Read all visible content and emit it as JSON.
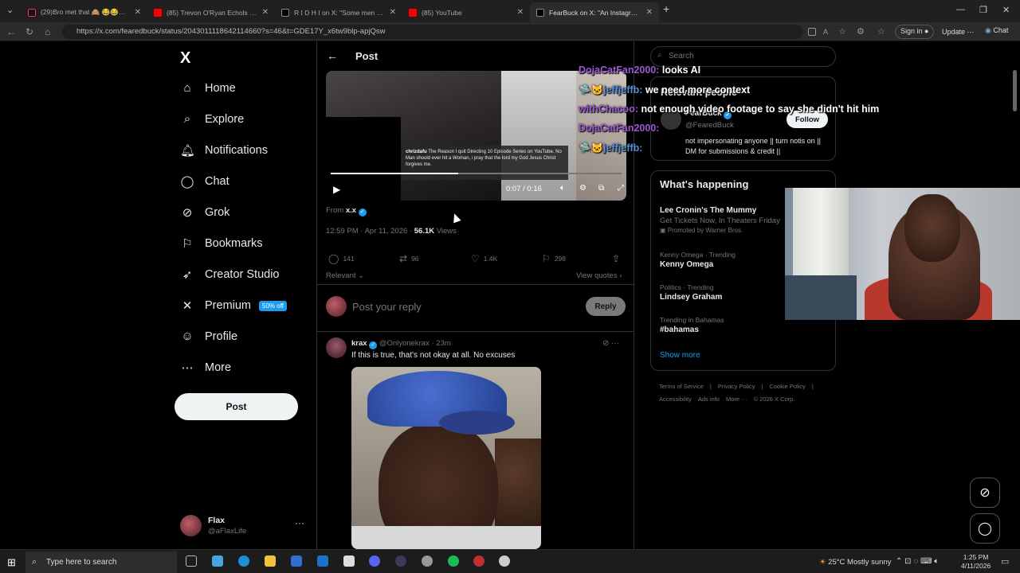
{
  "browser": {
    "tabs": [
      {
        "title": "(29)Bro met that 🙈 😂😂😂 #fy",
        "active": false,
        "color": "#fe2c55"
      },
      {
        "title": "(85) Trevon O'Ryan Echols - YouT",
        "active": false,
        "color": "#ff0000"
      },
      {
        "title": "R I D H I on X: \"Some men are sic",
        "active": false,
        "color": "#ffffff"
      },
      {
        "title": "(85) YouTube",
        "active": false,
        "color": "#ff0000"
      },
      {
        "title": "FearBuck on X: \"An Instagram use",
        "active": true,
        "color": "#ffffff"
      }
    ],
    "new_tab": "+",
    "url": "https://x.com/fearedbuck/status/2043011118642114660?s=46&t=GDE17Y_x6tw9blp-apjQsw",
    "sign_in": "Sign in",
    "update": "Update",
    "chat": "Chat"
  },
  "sidebar": {
    "logo": "X",
    "items": [
      {
        "label": "Home",
        "icon": "home-icon",
        "glyph": "⌂"
      },
      {
        "label": "Explore",
        "icon": "search-icon",
        "glyph": "⌕"
      },
      {
        "label": "Notifications",
        "icon": "bell-icon",
        "glyph": "🔔︎"
      },
      {
        "label": "Chat",
        "icon": "chat-bubble-icon",
        "glyph": "◯"
      },
      {
        "label": "Grok",
        "icon": "grok-icon",
        "glyph": "⊘"
      },
      {
        "label": "Bookmarks",
        "icon": "bookmark-icon",
        "glyph": "⚐"
      },
      {
        "label": "Creator Studio",
        "icon": "rocket-icon",
        "glyph": "➶"
      },
      {
        "label": "Premium",
        "icon": "x-icon",
        "glyph": "✕",
        "badge": "50% off"
      },
      {
        "label": "Profile",
        "icon": "person-icon",
        "glyph": "☺"
      },
      {
        "label": "More",
        "icon": "more-circle-icon",
        "glyph": "⋯"
      }
    ],
    "post_button": "Post",
    "account": {
      "name": "Flax",
      "handle": "@aFlaxLife",
      "more": "···"
    }
  },
  "post": {
    "header": "Post",
    "video": {
      "caption_user": "chrizdafu",
      "caption_text": "The Reason I quit Directing 10 Episode Series on YouTube. No Man should ever hit a Woman, i pray that the lord my God Jesus Christ forgives me.",
      "time": "0:07 / 0:16",
      "progress": 0.4375
    },
    "from_label": "From",
    "from_user": "x.x",
    "timestamp": "12:59 PM · Apr 11, 2026",
    "views_count": "56.1K",
    "views_label": "Views",
    "actions": {
      "replies": "141",
      "reposts": "96",
      "likes": "1.4K",
      "bookmarks": "298"
    },
    "relevant": "Relevant",
    "view_quotes": "View quotes",
    "reply_placeholder": "Post your reply",
    "reply_button": "Reply"
  },
  "reply_tweet": {
    "name": "krax",
    "handle": "@Onlyonekrax",
    "time": "23m",
    "text": "If this is true, that's not okay at all. No excuses"
  },
  "right": {
    "search_placeholder": "Search",
    "relevant_people_title": "Relevant people",
    "person": {
      "name": "FearBuck",
      "handle": "@FearedBuck",
      "follow": "Follow",
      "bio": "not impersonating anyone || turn notis on || DM for submissions & credit ||"
    },
    "whats_happening": "What's happening",
    "trends": [
      {
        "context": "",
        "title": "Lee Cronin's The Mummy",
        "sub": "Get Tickets Now, In Theaters Friday",
        "promo": "Promoted by Warner Bros."
      },
      {
        "context": "Kenny Omega · Trending",
        "title": "Kenny Omega",
        "sub": "",
        "promo": ""
      },
      {
        "context": "Politics · Trending",
        "title": "Lindsey Graham",
        "sub": "",
        "promo": ""
      },
      {
        "context": "Trending in Bahamas",
        "title": "#bahamas",
        "sub": "",
        "promo": ""
      }
    ],
    "show_more": "Show more",
    "footer": [
      "Terms of Service",
      "|",
      "Privacy Policy",
      "|",
      "Cookie Policy",
      "|",
      "Accessibility",
      "Ads info",
      "More ···",
      "© 2026 X Corp."
    ]
  },
  "overlay_chat": [
    {
      "user": "DojaCatFan2000:",
      "msg": "looks AI"
    },
    {
      "user": "jeffjeffb:",
      "msg": "we need more context"
    },
    {
      "user": "withChacoo:",
      "msg": "not enough video footage to say she didn't hit him"
    },
    {
      "user": "DojaCatFan2000:",
      "msg": ""
    },
    {
      "user": "jeffjeffb:",
      "msg": ""
    }
  ],
  "taskbar": {
    "search_placeholder": "Type here to search",
    "weather": "25°C  Mostly sunny",
    "time": "1:25 PM",
    "date": "4/11/2026"
  }
}
